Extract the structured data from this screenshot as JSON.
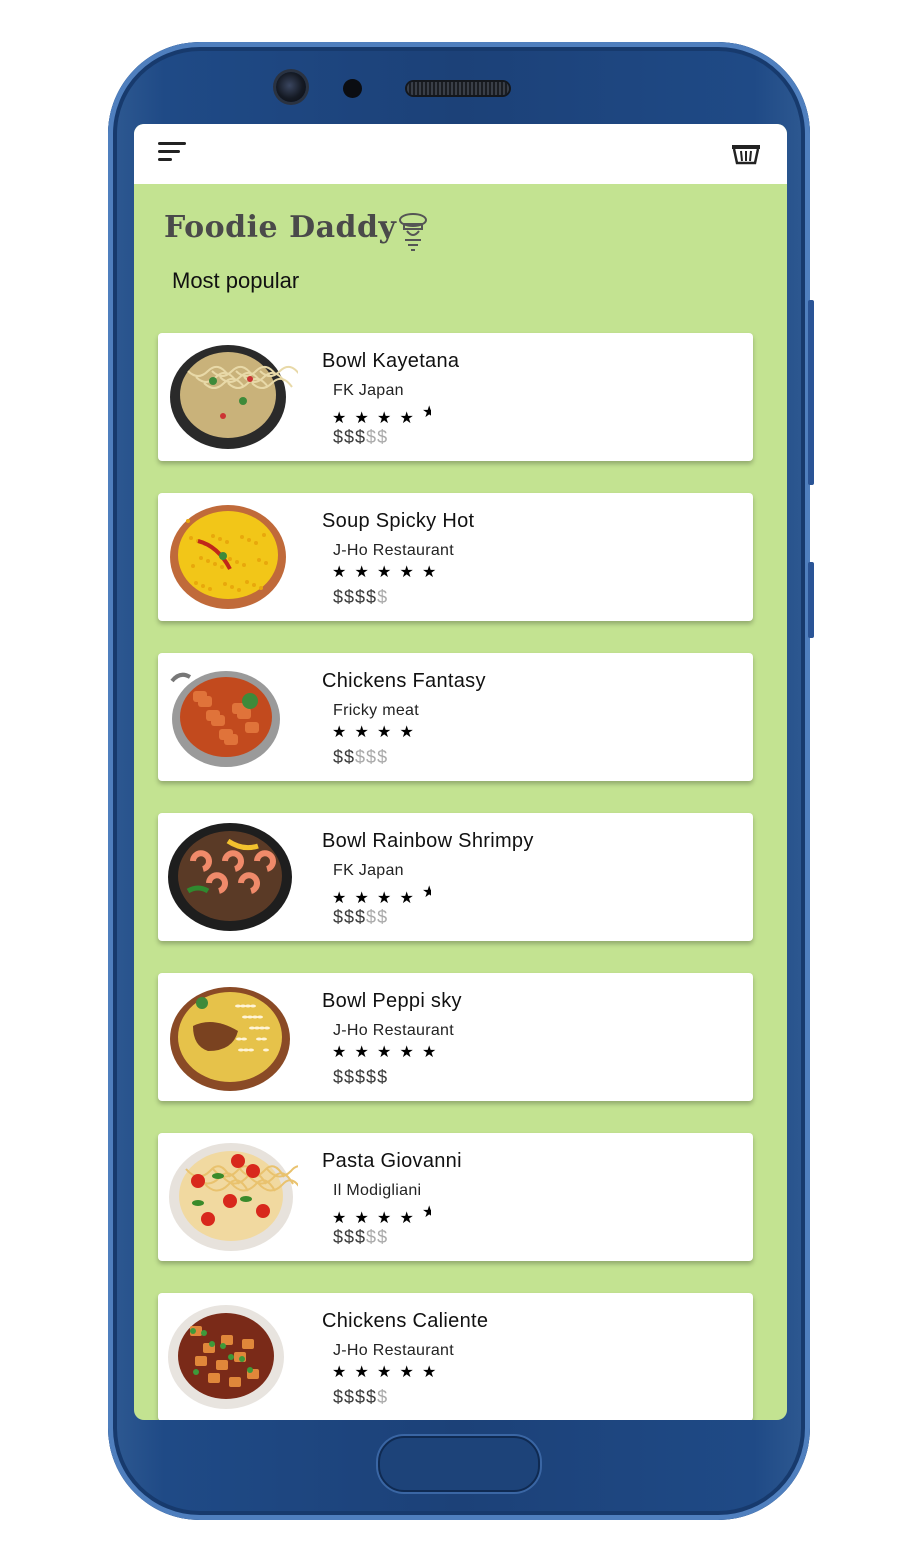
{
  "app": {
    "title": "Foodie Daddy",
    "section_title": "Most popular",
    "colors": {
      "background": "#c3e391",
      "card": "#ffffff",
      "frame": "#1c4178"
    }
  },
  "topbar": {
    "menu_icon": "menu-icon",
    "cart_icon": "basket-icon"
  },
  "dishes": [
    {
      "name": "Bowl Kayetana",
      "restaurant": "FK Japan",
      "rating": 4.5,
      "price_level": 3,
      "price_max": 5,
      "image": "noodle-bowl"
    },
    {
      "name": "Soup Spicky Hot",
      "restaurant": "J-Ho Restaurant",
      "rating": 5,
      "price_level": 4,
      "price_max": 5,
      "image": "yellow-soup"
    },
    {
      "name": "Chickens Fantasy",
      "restaurant": "Fricky meat",
      "rating": 4,
      "price_level": 2,
      "price_max": 5,
      "image": "chicken-curry-pot"
    },
    {
      "name": "Bowl Rainbow Shrimpy",
      "restaurant": "FK Japan",
      "rating": 4.5,
      "price_level": 3,
      "price_max": 5,
      "image": "shrimp-noodles"
    },
    {
      "name": "Bowl Peppi sky",
      "restaurant": "J-Ho Restaurant",
      "rating": 5,
      "price_level": 5,
      "price_max": 5,
      "image": "biryani-bowl"
    },
    {
      "name": "Pasta Giovanni",
      "restaurant": "Il Modigliani",
      "rating": 4.5,
      "price_level": 3,
      "price_max": 5,
      "image": "tomato-spaghetti"
    },
    {
      "name": "Chickens Caliente",
      "restaurant": "J-Ho Restaurant",
      "rating": 5,
      "price_level": 4,
      "price_max": 5,
      "image": "chicken-stir-fry"
    }
  ]
}
